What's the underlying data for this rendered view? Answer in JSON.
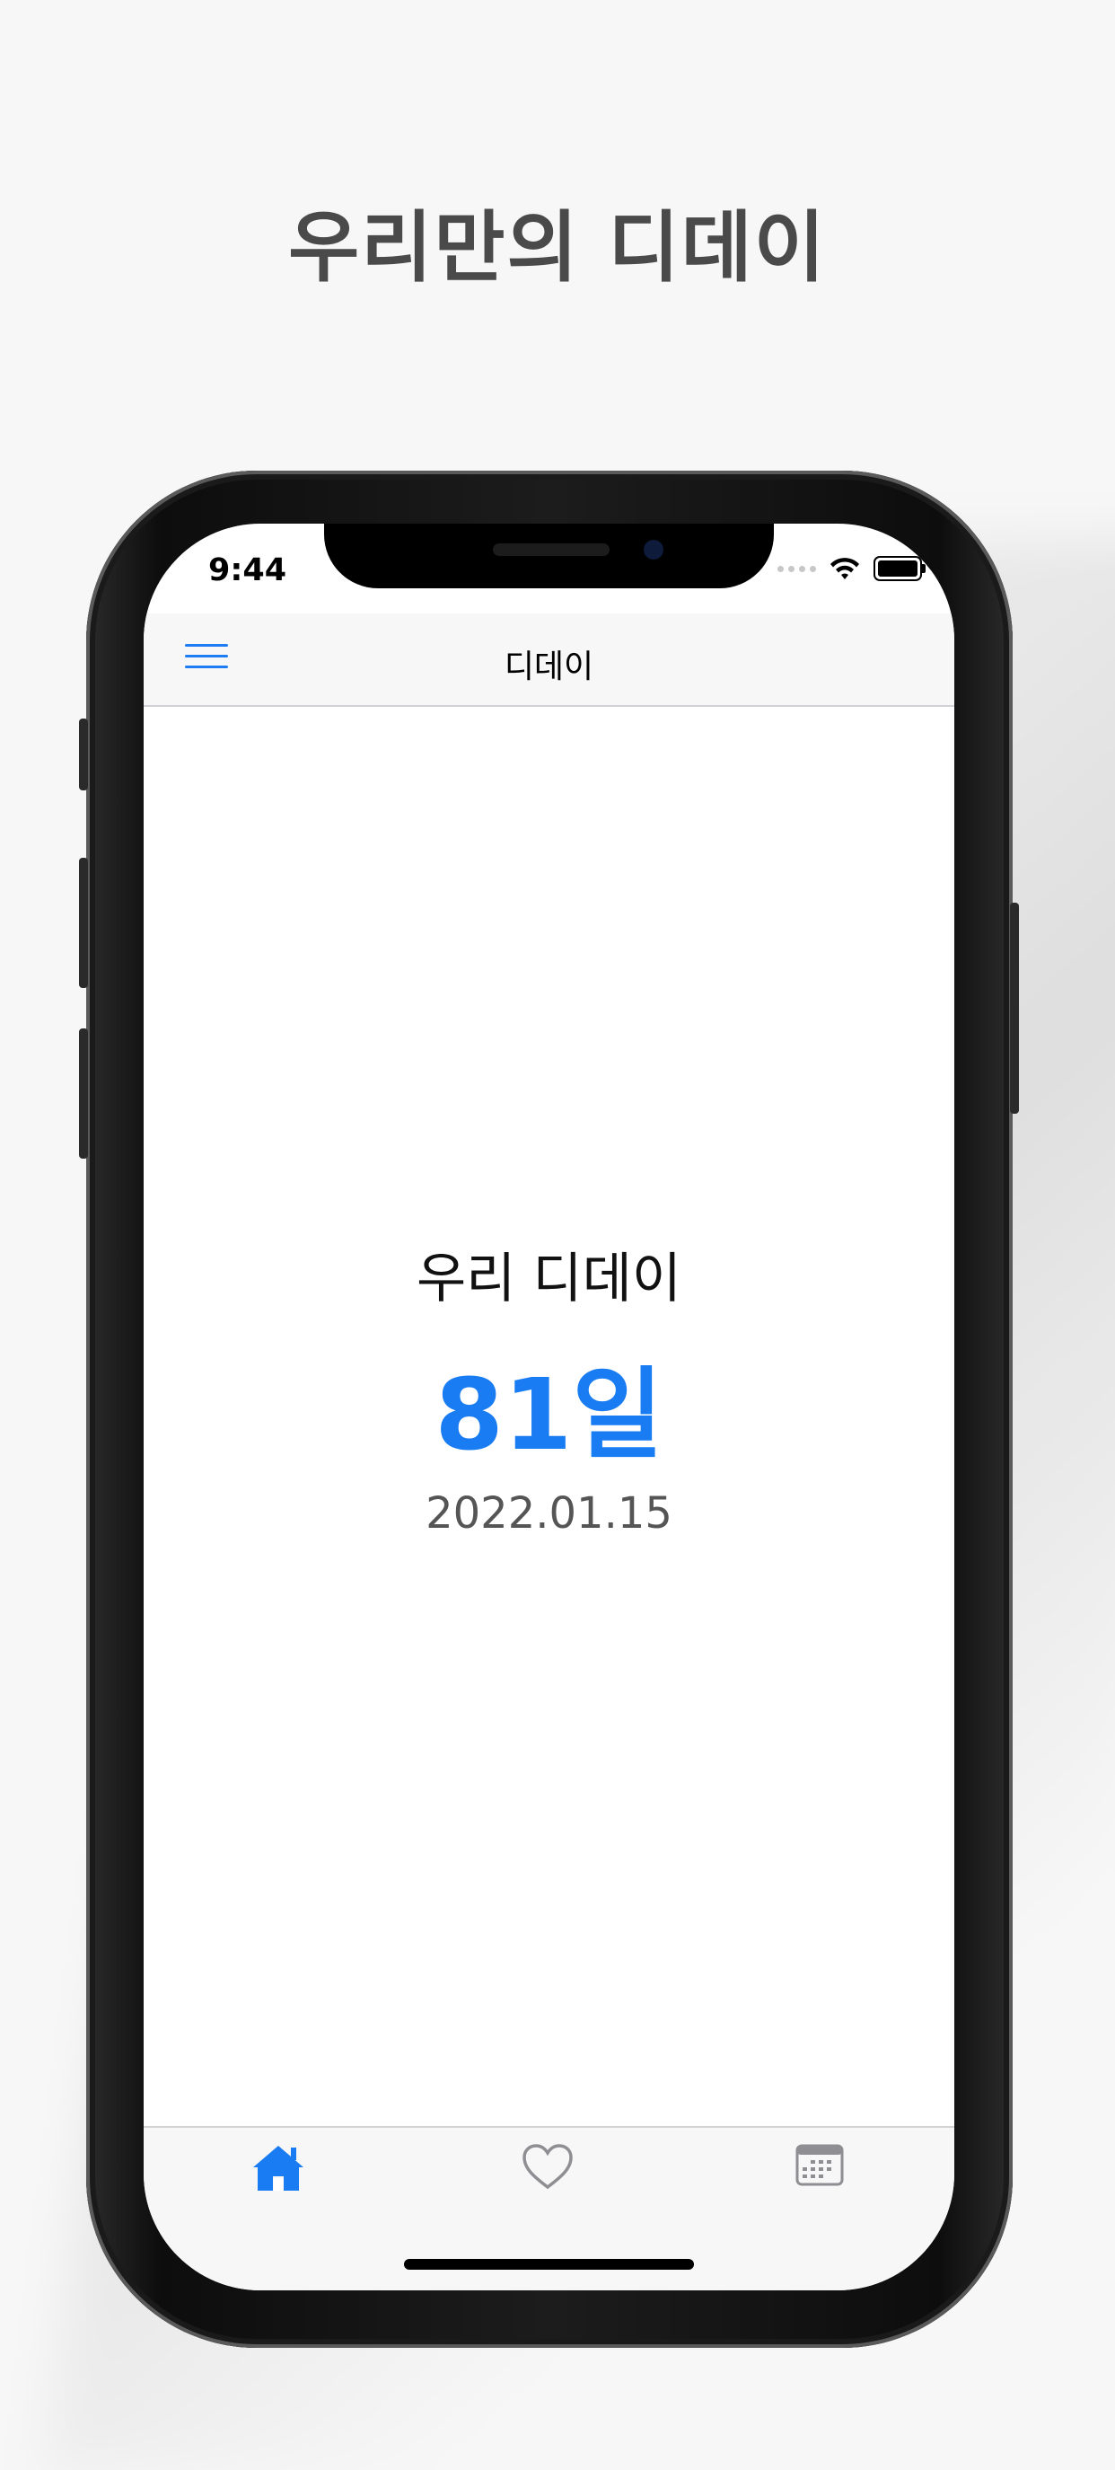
{
  "promo": {
    "title": "우리만의 디데이"
  },
  "status_bar": {
    "time": "9:44"
  },
  "navbar": {
    "title": "디데이",
    "menu_icon": "hamburger-menu-icon"
  },
  "main": {
    "label": "우리 디데이",
    "count": "81일",
    "date": "2022.01.15"
  },
  "tabbar": {
    "tabs": [
      {
        "icon": "home-icon",
        "selected": true
      },
      {
        "icon": "heart-icon",
        "selected": false
      },
      {
        "icon": "calendar-icon",
        "selected": false
      }
    ]
  },
  "colors": {
    "accent": "#1a7cf2",
    "inactive": "#8e8e93",
    "title_gray": "#4a4a4a"
  }
}
